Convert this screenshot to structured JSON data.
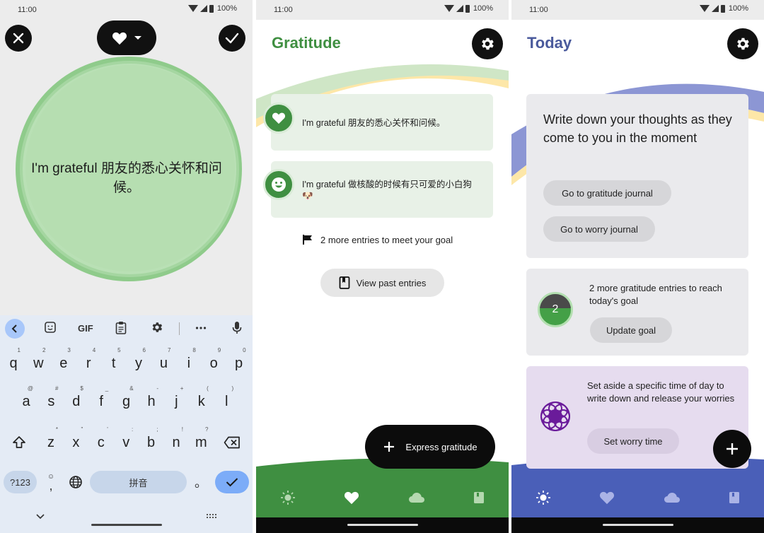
{
  "status_bar": {
    "time": "11:00",
    "battery": "100%"
  },
  "editor": {
    "text": "I'm grateful 朋友的悉心关怀和问候。"
  },
  "keyboard": {
    "toolbar_gif": "GIF",
    "row1": [
      {
        "k": "q",
        "h": "1"
      },
      {
        "k": "w",
        "h": "2"
      },
      {
        "k": "e",
        "h": "3"
      },
      {
        "k": "r",
        "h": "4"
      },
      {
        "k": "t",
        "h": "5"
      },
      {
        "k": "y",
        "h": "6"
      },
      {
        "k": "u",
        "h": "7"
      },
      {
        "k": "i",
        "h": "8"
      },
      {
        "k": "o",
        "h": "9"
      },
      {
        "k": "p",
        "h": "0"
      }
    ],
    "row2": [
      {
        "k": "a",
        "h": "@"
      },
      {
        "k": "s",
        "h": "#"
      },
      {
        "k": "d",
        "h": "$"
      },
      {
        "k": "f",
        "h": "_"
      },
      {
        "k": "g",
        "h": "&"
      },
      {
        "k": "h",
        "h": "-"
      },
      {
        "k": "j",
        "h": "+"
      },
      {
        "k": "k",
        "h": "("
      },
      {
        "k": "l",
        "h": ")"
      }
    ],
    "row3": [
      {
        "k": "z",
        "h": "*"
      },
      {
        "k": "x",
        "h": "\""
      },
      {
        "k": "c",
        "h": "'"
      },
      {
        "k": "v",
        "h": ":"
      },
      {
        "k": "b",
        "h": ";"
      },
      {
        "k": "n",
        "h": "!"
      },
      {
        "k": "m",
        "h": "?"
      }
    ],
    "symbols_key": "?123",
    "comma_key": ",",
    "emoji_hint": "☺",
    "space_key": "拼音",
    "period_key": "。"
  },
  "gratitude": {
    "title": "Gratitude",
    "entries": [
      {
        "text": "I'm grateful 朋友的悉心关怀和问候。",
        "icon": "heart-icon"
      },
      {
        "text": "I'm grateful 做核酸的时候有只可爱的小白狗 🐶",
        "icon": "smile-icon"
      }
    ],
    "goal_note": "2 more entries to meet your goal",
    "view_past": "View past entries",
    "fab_label": "Express gratitude"
  },
  "today": {
    "title": "Today",
    "prompt": "Write down your thoughts as they come to you in the moment",
    "gratitude_journal_btn": "Go to gratitude journal",
    "worry_journal_btn": "Go to worry journal",
    "goal_text": "2 more gratitude entries to reach today's goal",
    "goal_count": "2",
    "update_goal_btn": "Update goal",
    "worry_text": "Set aside a specific time of day to write down and release your worries",
    "worry_time_btn": "Set worry time"
  },
  "colors": {
    "gratitude_green": "#3f8f41",
    "today_blue": "#4a5fb8",
    "title_blue": "#4a5a9c",
    "dark": "#111111"
  }
}
